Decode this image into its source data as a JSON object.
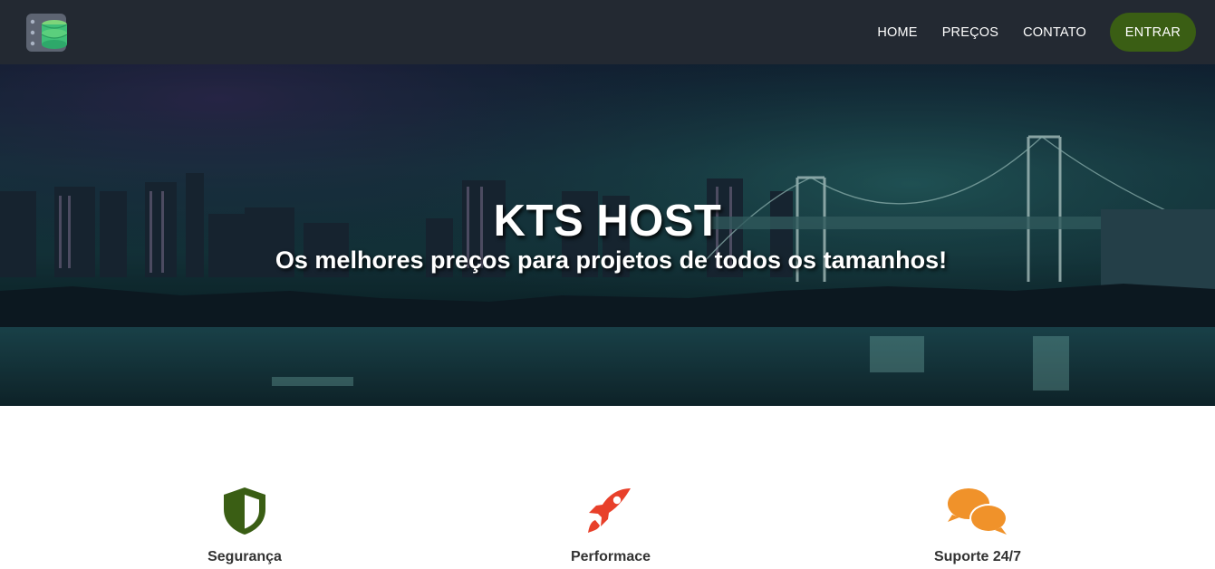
{
  "brand": {
    "logo_icon": "server-database-icon"
  },
  "nav": {
    "links": [
      "HOME",
      "PREÇOS",
      "CONTATO"
    ],
    "enter_label": "ENTRAR",
    "enter_color": "#3a5e14",
    "bg_color": "#232932"
  },
  "hero": {
    "title": "KTS HOST",
    "subtitle": "Os melhores preços para projetos de todos os tamanhos!"
  },
  "features": [
    {
      "label": "Segurança",
      "icon": "shield-icon",
      "color": "#3a5e14"
    },
    {
      "label": "Performace",
      "icon": "rocket-icon",
      "color": "#e8402a"
    },
    {
      "label": "Suporte 24/7",
      "icon": "chat-bubbles-icon",
      "color": "#f0922a"
    }
  ]
}
